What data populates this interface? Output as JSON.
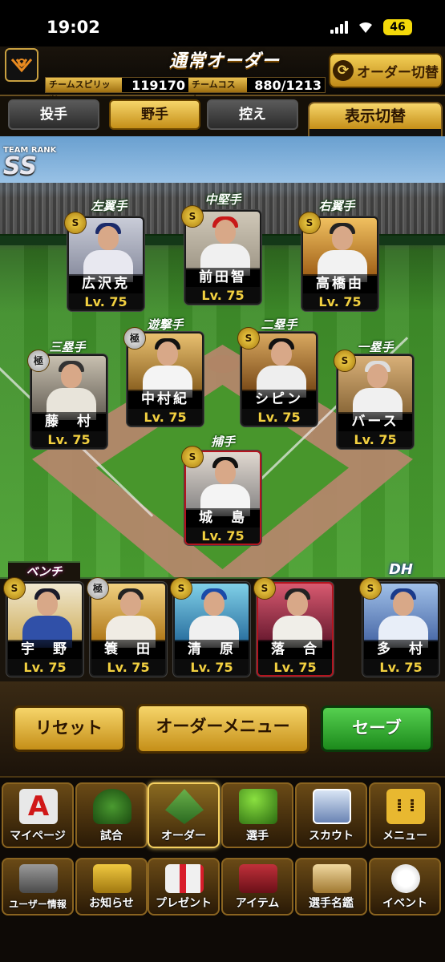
{
  "status_bar": {
    "time": "19:02",
    "battery": "46"
  },
  "header": {
    "title": "通常オーダー",
    "team_spirit_label": "チームスピリッツ",
    "team_spirit_value": "119170",
    "team_cost_label": "チームコスト",
    "team_cost_value": "880/1213",
    "order_switch_label": "オーダー切替"
  },
  "tabs": [
    {
      "label": "投手",
      "active": false
    },
    {
      "label": "野手",
      "active": true
    },
    {
      "label": "控え",
      "active": false
    }
  ],
  "display_switch": {
    "label": "表示切替",
    "value": "ー"
  },
  "team_rank": {
    "label": "TEAM RANK",
    "value": "SS"
  },
  "positions": {
    "lf": {
      "label": "左翼手",
      "name": "広沢克",
      "level": "Lv. 75",
      "badge": "S"
    },
    "cf": {
      "label": "中堅手",
      "name": "前田智",
      "level": "Lv. 75",
      "badge": "S"
    },
    "rf": {
      "label": "右翼手",
      "name": "高橋由",
      "level": "Lv. 75",
      "badge": "S"
    },
    "ss": {
      "label": "遊撃手",
      "name": "中村紀",
      "level": "Lv. 75",
      "badge": "極"
    },
    "b2": {
      "label": "二塁手",
      "name": "シピン",
      "level": "Lv. 75",
      "badge": "S"
    },
    "b3": {
      "label": "三塁手",
      "name": "藤　村",
      "level": "Lv. 75",
      "badge": "極"
    },
    "b1": {
      "label": "一塁手",
      "name": "バース",
      "level": "Lv. 75",
      "badge": "S"
    },
    "c": {
      "label": "捕手",
      "name": "城　島",
      "level": "Lv. 75",
      "badge": "S"
    }
  },
  "bench": {
    "label": "ベンチ",
    "dh_label": "DH",
    "players": [
      {
        "name": "宇　野",
        "level": "Lv. 75",
        "badge": "S"
      },
      {
        "name": "簑　田",
        "level": "Lv. 75",
        "badge": "極"
      },
      {
        "name": "清　原",
        "level": "Lv. 75",
        "badge": "S"
      },
      {
        "name": "落　合",
        "level": "Lv. 75",
        "badge": "S"
      }
    ],
    "dh": {
      "name": "多　村",
      "level": "Lv. 75",
      "badge": "S"
    }
  },
  "actions": {
    "reset": "リセット",
    "order_menu": "オーダーメニュー",
    "save": "セーブ"
  },
  "nav_row1": [
    {
      "label": "マイページ",
      "icon": "mypage-icon"
    },
    {
      "label": "試合",
      "icon": "stadium-icon"
    },
    {
      "label": "オーダー",
      "icon": "order-icon"
    },
    {
      "label": "選手",
      "icon": "player-icon"
    },
    {
      "label": "スカウト",
      "icon": "scout-icon"
    },
    {
      "label": "メニュー",
      "icon": "menu-icon"
    }
  ],
  "nav_row2": [
    {
      "label": "ユーザー情報",
      "icon": "user-info-icon"
    },
    {
      "label": "お知らせ",
      "icon": "news-icon"
    },
    {
      "label": "プレゼント",
      "icon": "present-icon"
    },
    {
      "label": "アイテム",
      "icon": "item-icon"
    },
    {
      "label": "選手名鑑",
      "icon": "player-directory-icon"
    },
    {
      "label": "イベント",
      "icon": "event-icon"
    }
  ]
}
